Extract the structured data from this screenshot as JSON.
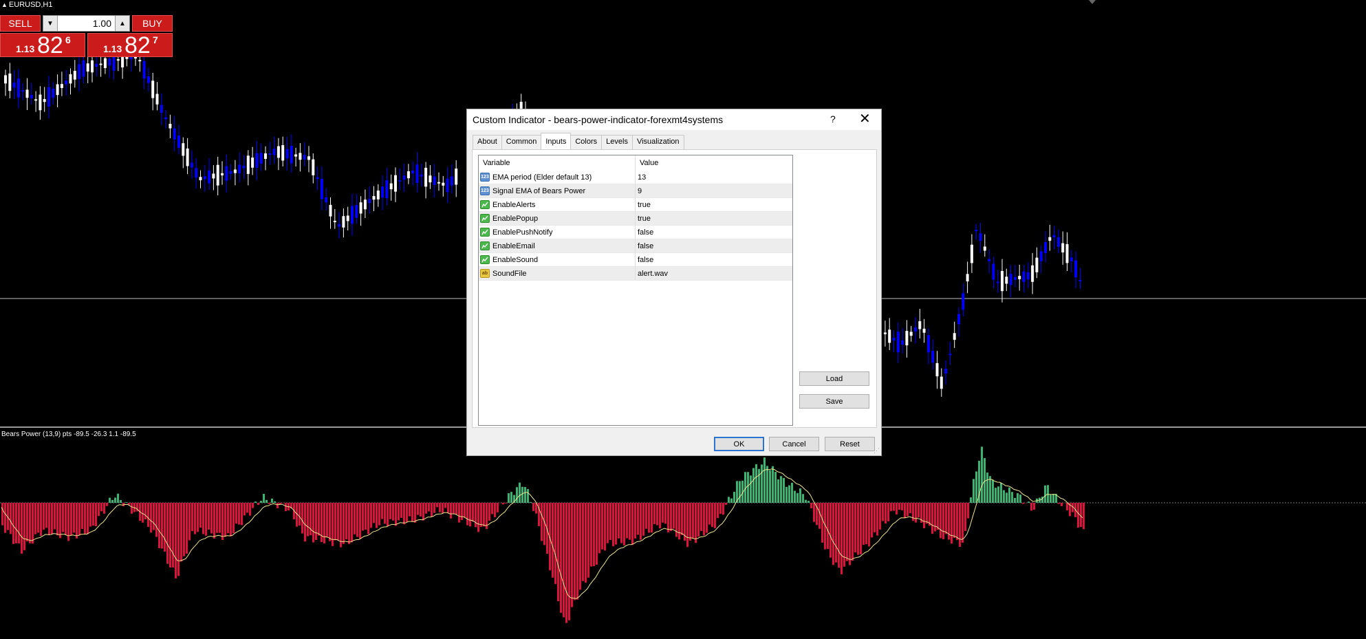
{
  "chart": {
    "title": "EURUSD,H1",
    "indicator_label": "Bears Power (13,9) pts -89.5 -26.3 1.1 -89.5",
    "colors": {
      "background": "#000000",
      "bull_candle": "#ffffff",
      "bear_candle": "#0000ff",
      "histogram_negative": "#dc143c",
      "histogram_positive": "#3cb371",
      "signal_line": "#f0e68c"
    }
  },
  "trade_panel": {
    "sell_label": "SELL",
    "buy_label": "BUY",
    "lot": "1.00",
    "bid": {
      "small": "1.13",
      "big": "82",
      "sup": "6"
    },
    "ask": {
      "small": "1.13",
      "big": "82",
      "sup": "7"
    },
    "down_icon": "triangle-down-icon",
    "up_icon": "triangle-up-icon"
  },
  "dialog": {
    "title": "Custom Indicator - bears-power-indicator-forexmt4systems",
    "help": "?",
    "close": "✕",
    "tabs": [
      {
        "label": "About"
      },
      {
        "label": "Common"
      },
      {
        "label": "Inputs",
        "active": true
      },
      {
        "label": "Colors"
      },
      {
        "label": "Levels"
      },
      {
        "label": "Visualization"
      }
    ],
    "table": {
      "col_variable": "Variable",
      "col_value": "Value",
      "rows": [
        {
          "variable": "EMA period (Elder default 13)",
          "value": "13",
          "type": "int"
        },
        {
          "variable": "Signal EMA of Bears Power",
          "value": "9",
          "type": "int"
        },
        {
          "variable": "EnableAlerts",
          "value": "true",
          "type": "bool"
        },
        {
          "variable": "EnablePopup",
          "value": "true",
          "type": "bool"
        },
        {
          "variable": "EnablePushNotify",
          "value": "false",
          "type": "bool"
        },
        {
          "variable": "EnableEmail",
          "value": "false",
          "type": "bool"
        },
        {
          "variable": "EnableSound",
          "value": "false",
          "type": "bool"
        },
        {
          "variable": "SoundFile",
          "value": "alert.wav",
          "type": "string"
        }
      ]
    },
    "buttons": {
      "load": "Load",
      "save": "Save",
      "ok": "OK",
      "cancel": "Cancel",
      "reset": "Reset"
    },
    "icons": {
      "int": "123",
      "bool": "",
      "string": "ab"
    }
  }
}
